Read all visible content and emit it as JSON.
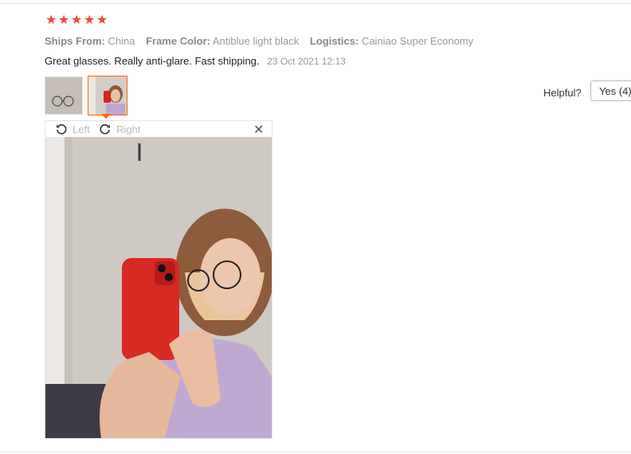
{
  "rating": {
    "stars": 5
  },
  "meta": {
    "ships_from_label": "Ships From:",
    "ships_from_value": "China",
    "frame_color_label": "Frame Color:",
    "frame_color_value": "Antiblue light black",
    "logistics_label": "Logistics:",
    "logistics_value": "Cainiao Super Economy"
  },
  "review": {
    "text": "Great glasses. Really anti-glare. Fast shipping.",
    "date": "23 Oct 2021 12:13"
  },
  "helpful": {
    "label": "Helpful?",
    "yes_label": "Yes (4)"
  },
  "viewer": {
    "rotate_left_label": "Left",
    "rotate_right_label": "Right",
    "close_glyph": "✕"
  },
  "colors": {
    "star": "#f44336",
    "selected_thumb_border": "#ff6600"
  }
}
